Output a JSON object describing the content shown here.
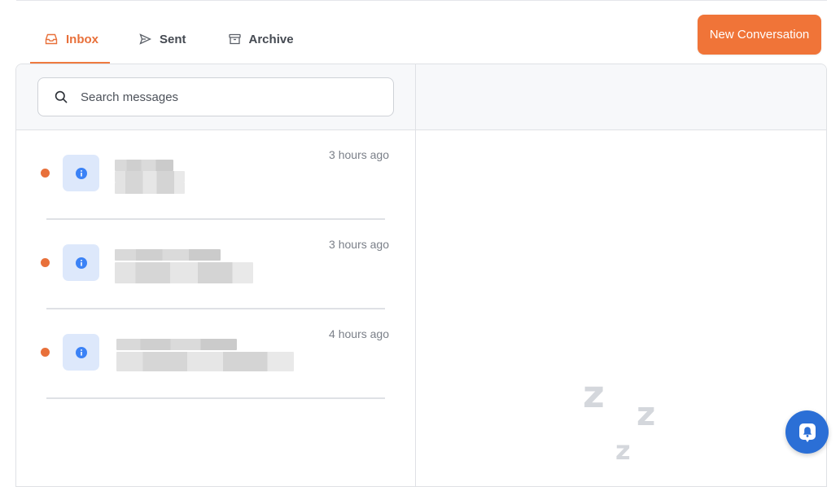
{
  "tabs": [
    {
      "label": "Inbox",
      "icon": "inbox-icon",
      "active": true
    },
    {
      "label": "Sent",
      "icon": "send-icon",
      "active": false
    },
    {
      "label": "Archive",
      "icon": "archive-icon",
      "active": false
    }
  ],
  "toolbar": {
    "new_conversation_label": "New Conversation"
  },
  "search": {
    "placeholder": "Search messages",
    "value": ""
  },
  "conversations": [
    {
      "time": "3 hours ago",
      "unread": true,
      "avatar_icon": "info-icon"
    },
    {
      "time": "3 hours ago",
      "unread": true,
      "avatar_icon": "info-icon"
    },
    {
      "time": "4 hours ago",
      "unread": true,
      "avatar_icon": "info-icon"
    }
  ],
  "empty_state": {
    "icon": "sleeping-zzz-icon"
  },
  "colors": {
    "accent": "#f07438",
    "unread_dot": "#e8703a",
    "info_blue": "#3b82f6",
    "fab_blue": "#2b6fd6"
  }
}
